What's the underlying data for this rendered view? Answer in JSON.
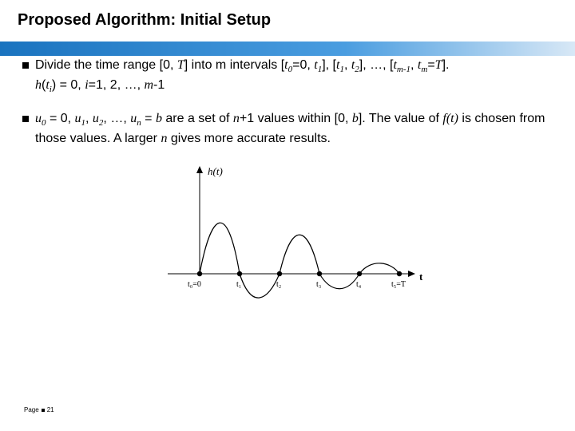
{
  "title": "Proposed Algorithm: Initial Setup",
  "bullets": {
    "b1_main": "Divide the time range [0, ",
    "b1_T": "T",
    "b1_mid1": "] into m intervals [",
    "b1_t": "t",
    "b1_eq0": "=0, ",
    "b1_comma": "], [",
    "b1_dots": "], …, [",
    "b1_tmEq": "=",
    "b1_end": "].",
    "b1_sub0": "0",
    "b1_sub1": "1",
    "b1_sub2": "2",
    "b1_subm1": "m-1",
    "b1_subm": "m",
    "b1_line2_pre": "h",
    "b1_line2_paren1": "(",
    "b1_line2_ti": "t",
    "b1_line2_i": "i",
    "b1_line2_paren2": ")",
    "b1_line2_eq": " = 0, ",
    "b1_line2_ieq": "i",
    "b1_line2_rest": "=1, 2, …, ",
    "b1_line2_m": "m",
    "b1_line2_minus1": "-1",
    "b2_u": "u",
    "b2_s0": "0",
    "b2_eq0": " = 0, ",
    "b2_s1": "1",
    "b2_c": ", ",
    "b2_s2": "2",
    "b2_dots": ", …, ",
    "b2_sn": "n",
    "b2_eqb": " = ",
    "b2_b": "b",
    "b2_mid1": " are a set of ",
    "b2_n": "n",
    "b2_plus1": "+1",
    "b2_mid2": " values within [0, ",
    "b2_mid3": "]. The value of ",
    "b2_ft": "f(t)",
    "b2_mid4": " is chosen from those values. A larger ",
    "b2_mid5": " gives more accurate results."
  },
  "figure": {
    "ylabel": "h(t)",
    "xlabel": "t",
    "ticks": [
      "t₀=0",
      "t₁",
      "t₂",
      "t₃",
      "t₄",
      "t₅=T"
    ]
  },
  "footer": {
    "page_label": "Page",
    "page_num": "21"
  }
}
